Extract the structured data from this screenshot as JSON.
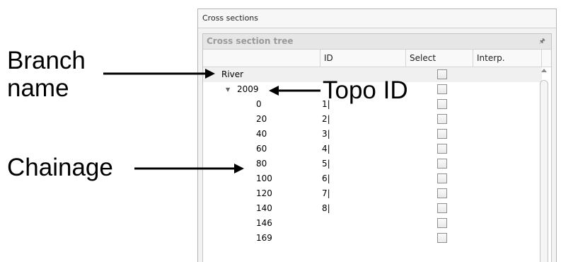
{
  "annotations": {
    "branch_name_line1": "Branch",
    "branch_name_line2": "name",
    "topo_id": "Topo ID",
    "chainage": "Chainage"
  },
  "window": {
    "title": "Cross sections"
  },
  "panel": {
    "title": "Cross section tree",
    "pin_icon": "pin-icon"
  },
  "columns": [
    "",
    "ID",
    "Select",
    "Interp."
  ],
  "tree": {
    "branch": "River",
    "topo": "2009",
    "rows": [
      {
        "chainage": "0",
        "id": "1|"
      },
      {
        "chainage": "20",
        "id": "2|"
      },
      {
        "chainage": "40",
        "id": "3|"
      },
      {
        "chainage": "60",
        "id": "4|"
      },
      {
        "chainage": "80",
        "id": "5|"
      },
      {
        "chainage": "100",
        "id": "6|"
      },
      {
        "chainage": "120",
        "id": "7|"
      },
      {
        "chainage": "140",
        "id": "8|"
      },
      {
        "chainage": "146",
        "id": ""
      },
      {
        "chainage": "169",
        "id": ""
      }
    ]
  }
}
